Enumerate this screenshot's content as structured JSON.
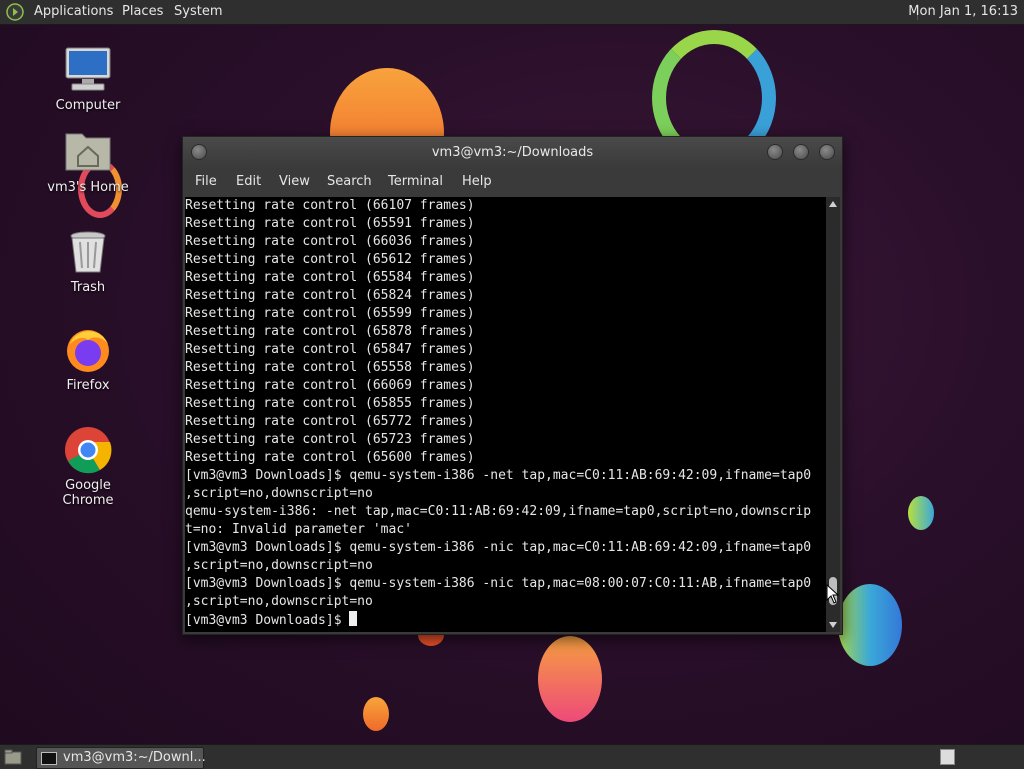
{
  "top_panel": {
    "menu": [
      "Applications",
      "Places",
      "System"
    ],
    "clock": "Mon Jan 1, 16:13"
  },
  "desktop_icons": [
    {
      "label": "Computer",
      "icon": "computer-icon"
    },
    {
      "label": "vm3's Home",
      "icon": "home-folder-icon"
    },
    {
      "label": "Trash",
      "icon": "trash-icon"
    },
    {
      "label": "Firefox",
      "icon": "firefox-icon"
    },
    {
      "label": "Google Chrome",
      "icon": "chrome-icon"
    }
  ],
  "terminal": {
    "title": "vm3@vm3:~/Downloads",
    "menu": [
      "File",
      "Edit",
      "View",
      "Search",
      "Terminal",
      "Help"
    ],
    "lines": [
      "Resetting rate control (66107 frames)",
      "Resetting rate control (65591 frames)",
      "Resetting rate control (66036 frames)",
      "Resetting rate control (65612 frames)",
      "Resetting rate control (65584 frames)",
      "Resetting rate control (65824 frames)",
      "Resetting rate control (65599 frames)",
      "Resetting rate control (65878 frames)",
      "Resetting rate control (65847 frames)",
      "Resetting rate control (65558 frames)",
      "Resetting rate control (66069 frames)",
      "Resetting rate control (65855 frames)",
      "Resetting rate control (65772 frames)",
      "Resetting rate control (65723 frames)",
      "Resetting rate control (65600 frames)",
      "[vm3@vm3 Downloads]$ qemu-system-i386 -net tap,mac=C0:11:AB:69:42:09,ifname=tap0",
      ",script=no,downscript=no",
      "qemu-system-i386: -net tap,mac=C0:11:AB:69:42:09,ifname=tap0,script=no,downscrip",
      "t=no: Invalid parameter 'mac'",
      "[vm3@vm3 Downloads]$ qemu-system-i386 -nic tap,mac=C0:11:AB:69:42:09,ifname=tap0",
      ",script=no,downscript=no",
      "[vm3@vm3 Downloads]$ qemu-system-i386 -nic tap,mac=08:00:07:C0:11:AB,ifname=tap0",
      ",script=no,downscript=no"
    ],
    "prompt": "[vm3@vm3 Downloads]$ "
  },
  "taskbar": {
    "window_label": "vm3@vm3:~/Downl..."
  }
}
